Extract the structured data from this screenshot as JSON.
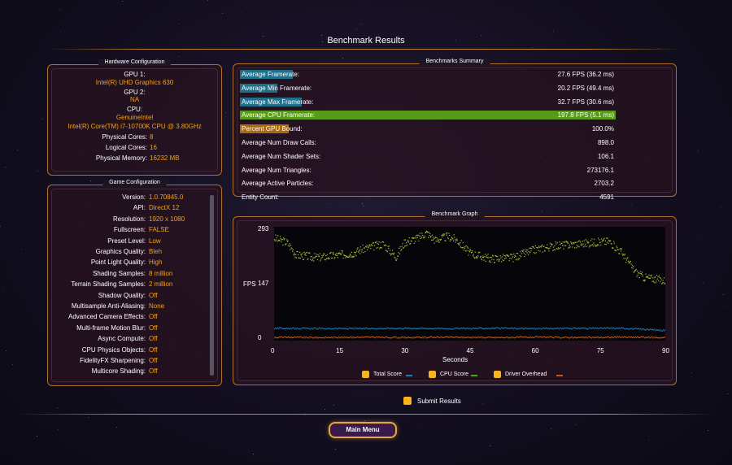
{
  "title": "Benchmark Results",
  "hardware": {
    "panel_title": "Hardware Configuration",
    "gpu1_label": "GPU 1:",
    "gpu1_value": "Intel(R) UHD Graphics 630",
    "gpu2_label": "GPU 2:",
    "gpu2_value": "NA",
    "cpu_label": "CPU:",
    "cpu_vendor": "GenuineIntel",
    "cpu_value": "Intel(R) Core(TM) i7-10700K CPU @ 3.80GHz",
    "rows": [
      {
        "label": "Physical Cores:",
        "value": "8"
      },
      {
        "label": "Logical Cores:",
        "value": "16"
      },
      {
        "label": "Physical Memory:",
        "value": "16232  MB"
      }
    ]
  },
  "game_config": {
    "panel_title": "Game Configuration",
    "rows": [
      {
        "label": "Version:",
        "value": "1.0.70845.0"
      },
      {
        "label": "API:",
        "value": "DirectX 12"
      },
      {
        "label": "Resolution:",
        "value": "1920 x 1080"
      },
      {
        "label": "Fullscreen:",
        "value": "FALSE"
      },
      {
        "label": "Preset Level:",
        "value": "Low"
      },
      {
        "label": "Graphics Quality:",
        "value": "Bleh"
      },
      {
        "label": "Point Light Quality:",
        "value": "High"
      },
      {
        "label": "Shading Samples:",
        "value": "8 million"
      },
      {
        "label": "Terrain Shading Samples:",
        "value": "2 million"
      },
      {
        "label": "Shadow Quality:",
        "value": "Off"
      },
      {
        "label": "Multisample Anti-Aliasing:",
        "value": "None"
      },
      {
        "label": "Advanced Camera Effects:",
        "value": "Off"
      },
      {
        "label": "Multi-frame Motion Blur:",
        "value": "Off"
      },
      {
        "label": "Async Compute:",
        "value": "Off"
      },
      {
        "label": "CPU Physics Objects:",
        "value": "Off"
      },
      {
        "label": "FidelityFX Sharpening:",
        "value": "Off"
      },
      {
        "label": "Multicore Shading:",
        "value": "Off"
      }
    ]
  },
  "summary": {
    "panel_title": "Benchmarks Summary",
    "rows": [
      {
        "label": "Average Framerate:",
        "value": "27.6 FPS (36.2 ms)",
        "bar_color": "#1f6f8a",
        "bar_fraction": 0.14
      },
      {
        "label": "Average Min Framerate:",
        "value": "20.2 FPS (49.4 ms)",
        "bar_color": "#1f6f8a",
        "bar_fraction": 0.1
      },
      {
        "label": "Average Max Framerate:",
        "value": "32.7 FPS (30.6 ms)",
        "bar_color": "#1f6f8a",
        "bar_fraction": 0.165
      },
      {
        "label": "Average CPU Framerate:",
        "value": "197.8 FPS (5.1 ms)",
        "bar_color": "#5a9a1a",
        "bar_fraction": 1.0
      },
      {
        "label": "Percent GPU Bound:",
        "value": "100.0%",
        "bar_color": "#a86a12",
        "bar_fraction": 0.13
      },
      {
        "label": "Average Num Draw Calls:",
        "value": "898.0"
      },
      {
        "label": "Average Num Shader Sets:",
        "value": "106.1"
      },
      {
        "label": "Average Num Triangles:",
        "value": "273176.1"
      },
      {
        "label": "Average Active Particles:",
        "value": "2703.2"
      },
      {
        "label": "Entity Count:",
        "value": "4591"
      }
    ]
  },
  "graph": {
    "panel_title": "Benchmark Graph",
    "legend": [
      {
        "label": "Total Score",
        "color": "#1b7cb5"
      },
      {
        "label": "CPU Score",
        "color": "#4aa81c"
      },
      {
        "label": "Driver Overhead",
        "color": "#c0591a"
      }
    ]
  },
  "chart_data": {
    "type": "scatter",
    "title": "Benchmark Graph",
    "xlabel": "Seconds",
    "ylabel": "FPS",
    "xlim": [
      0,
      90
    ],
    "ylim": [
      0,
      293
    ],
    "x_ticks": [
      0,
      15,
      30,
      45,
      60,
      75,
      90
    ],
    "y_ticks": [
      0,
      147,
      293
    ],
    "series": [
      {
        "name": "CPU Score",
        "color": "#a6c43a",
        "x": [
          0,
          3,
          5,
          10,
          15,
          18,
          20,
          25,
          28,
          30,
          33,
          35,
          37,
          40,
          42,
          45,
          48,
          50,
          55,
          60,
          65,
          70,
          75,
          77,
          80,
          83,
          85,
          88,
          90
        ],
        "y": [
          270,
          258,
          225,
          218,
          225,
          230,
          240,
          255,
          220,
          260,
          270,
          285,
          265,
          275,
          265,
          230,
          220,
          215,
          218,
          240,
          250,
          255,
          260,
          262,
          230,
          180,
          165,
          160,
          155
        ]
      },
      {
        "name": "Total Score",
        "color": "#1b7cb5",
        "x": [
          0,
          10,
          20,
          30,
          40,
          50,
          60,
          70,
          80,
          85,
          90
        ],
        "y": [
          28,
          27,
          27,
          28,
          27,
          28,
          27,
          28,
          28,
          25,
          22
        ]
      },
      {
        "name": "Driver Overhead",
        "color": "#c0591a",
        "x": [
          0,
          10,
          20,
          30,
          40,
          50,
          60,
          70,
          80,
          90
        ],
        "y": [
          4,
          3,
          4,
          3,
          4,
          3,
          4,
          3,
          4,
          3
        ]
      }
    ]
  },
  "submit_label": "Submit Results",
  "main_menu_label": "Main Menu"
}
